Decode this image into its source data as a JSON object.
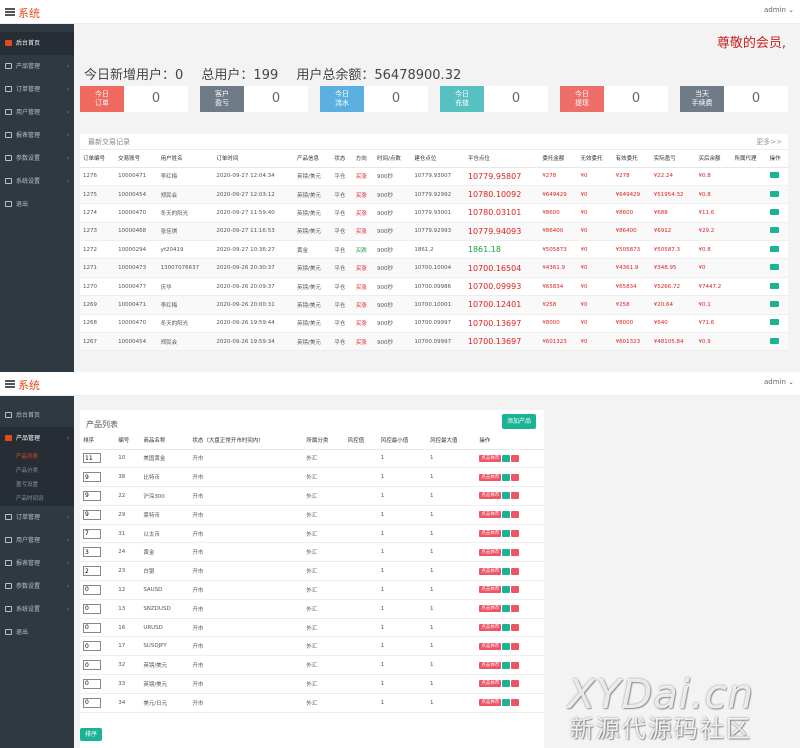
{
  "app": {
    "brand": "系统",
    "user": "admin ⌄"
  },
  "sidebar1": {
    "items": [
      {
        "label": "后台首页",
        "icon": "dashboard-icon",
        "active": true
      },
      {
        "label": "产品管理",
        "icon": "product-icon"
      },
      {
        "label": "订单管理",
        "icon": "order-icon"
      },
      {
        "label": "用户管理",
        "icon": "user-icon"
      },
      {
        "label": "报表管理",
        "icon": "report-icon"
      },
      {
        "label": "参数设置",
        "icon": "settings-icon"
      },
      {
        "label": "系统设置",
        "icon": "gear-icon"
      },
      {
        "label": "退出",
        "icon": "logout-icon"
      }
    ]
  },
  "dashboard": {
    "welcome": "尊敬的会员,",
    "stats": {
      "new_users": "今日新增用户：0",
      "total_users": "总用户：199",
      "total_balance": "用户总余额：56478900.32"
    },
    "cards": [
      {
        "label": "今日\n订单",
        "value": "0",
        "color": "#f0695f"
      },
      {
        "label": "客户\n盈亏",
        "value": "0",
        "color": "#6f7b86"
      },
      {
        "label": "今日\n流水",
        "value": "0",
        "color": "#5bb0e0"
      },
      {
        "label": "今日\n充值",
        "value": "0",
        "color": "#57c0c3"
      },
      {
        "label": "今日\n提现",
        "value": "0",
        "color": "#ee6f6a"
      },
      {
        "label": "当天\n手续费",
        "value": "0",
        "color": "#6f7b86"
      }
    ],
    "trades_title": "最新交易记录",
    "more": "更多>>",
    "columns": [
      "订单编号",
      "交易账号",
      "用户姓名",
      "订单时间",
      "产品信息",
      "状态",
      "方向",
      "时间/点数",
      "建仓点位",
      "平仓点位",
      "委托金额",
      "无效委托",
      "有效委托",
      "实际盈亏",
      "买后余额",
      "所属代理",
      "操作"
    ],
    "rows": [
      [
        "1276",
        "10000471",
        "李红梅",
        "2020-09-27 12:04:34",
        "英镑/美元",
        "平仓",
        "买涨",
        "900秒",
        "10779.93007",
        "10779.95807",
        "¥278",
        "¥0",
        "¥278",
        "¥22.24",
        "¥0.8",
        ""
      ],
      [
        "1275",
        "10000454",
        "郑民会",
        "2020-09-27 12:03:12",
        "英镑/美元",
        "平仓",
        "买涨",
        "900秒",
        "10779.92992",
        "10780.10092",
        "¥649429",
        "¥0",
        "¥649429",
        "¥51954.32",
        "¥0.8",
        ""
      ],
      [
        "1274",
        "10000470",
        "冬天的阳光",
        "2020-09-27 11:59:40",
        "英镑/美元",
        "平仓",
        "买涨",
        "900秒",
        "10779.93001",
        "10780.03101",
        "¥8600",
        "¥0",
        "¥8600",
        "¥688",
        "¥11.6",
        ""
      ],
      [
        "1273",
        "10000468",
        "张佳琪",
        "2020-09-27 11:16:53",
        "英镑/美元",
        "平仓",
        "买涨",
        "900秒",
        "10779.92993",
        "10779.94093",
        "¥86400",
        "¥0",
        "¥86400",
        "¥6912",
        "¥29.2",
        ""
      ],
      [
        "1272",
        "10000294",
        "yt20419",
        "2020-09-27 10:36:27",
        "黄金",
        "平仓",
        "买跌",
        "900秒",
        "1861.2",
        "1861.18",
        "¥505873",
        "¥0",
        "¥505873",
        "¥50587.3",
        "¥0.8",
        ""
      ],
      [
        "1271",
        "10000473",
        "13007076637",
        "2020-09-26 20:30:37",
        "英镑/美元",
        "平仓",
        "买涨",
        "900秒",
        "10700.10004",
        "10700.16504",
        "¥4361.9",
        "¥0",
        "¥4361.9",
        "¥348.95",
        "¥0",
        ""
      ],
      [
        "1270",
        "10000477",
        "庆华",
        "2020-09-26 20:09:37",
        "英镑/美元",
        "平仓",
        "买涨",
        "900秒",
        "10700.09986",
        "10700.09993",
        "¥65834",
        "¥0",
        "¥65834",
        "¥5266.72",
        "¥7447.2",
        ""
      ],
      [
        "1269",
        "10000471",
        "李红梅",
        "2020-09-26 20:00:31",
        "英镑/美元",
        "平仓",
        "买涨",
        "900秒",
        "10700.10001",
        "10700.12401",
        "¥258",
        "¥0",
        "¥258",
        "¥20.64",
        "¥0.1",
        ""
      ],
      [
        "1268",
        "10000470",
        "冬天的阳光",
        "2020-09-26 19:59:44",
        "英镑/美元",
        "平仓",
        "买涨",
        "900秒",
        "10700.09997",
        "10700.13697",
        "¥8000",
        "¥0",
        "¥8000",
        "¥640",
        "¥71.6",
        ""
      ],
      [
        "1267",
        "10000454",
        "郑民会",
        "2020-09-26 19:59:34",
        "英镑/美元",
        "平仓",
        "买涨",
        "900秒",
        "10700.09997",
        "10700.13697",
        "¥601323",
        "¥0",
        "¥601323",
        "¥48105.84",
        "¥0.9",
        ""
      ]
    ]
  },
  "sidebar2": {
    "items": [
      {
        "label": "后台首页",
        "icon": "dashboard-icon"
      },
      {
        "label": "产品管理",
        "icon": "product-icon",
        "active": true
      },
      {
        "label": "订单管理",
        "icon": "order-icon"
      },
      {
        "label": "用户管理",
        "icon": "user-icon"
      },
      {
        "label": "报表管理",
        "icon": "report-icon"
      },
      {
        "label": "参数设置",
        "icon": "settings-icon"
      },
      {
        "label": "系统设置",
        "icon": "gear-icon"
      },
      {
        "label": "退出",
        "icon": "logout-icon"
      }
    ],
    "subitems": [
      {
        "label": "产品列表",
        "active": true
      },
      {
        "label": "产品分类"
      },
      {
        "label": "盈亏设置"
      },
      {
        "label": "产品时间设"
      }
    ]
  },
  "products": {
    "title": "产品列表",
    "add_label": "添加产品",
    "columns": [
      "排序",
      "编号",
      "商品名称",
      "状态（大盘正常开市时间内）",
      "所属分类",
      "风控值",
      "风控最小值",
      "风控最大值",
      "操作"
    ],
    "action_label": "点击休市",
    "sort_button": "排序",
    "rows": [
      [
        "11",
        "10",
        "美国黄金",
        "开市",
        "外汇",
        "",
        "1",
        "1"
      ],
      [
        "9",
        "38",
        "比特币",
        "开市",
        "外汇",
        "",
        "1",
        "1"
      ],
      [
        "9",
        "22",
        "沪深300",
        "开市",
        "外汇",
        "",
        "1",
        "1"
      ],
      [
        "9",
        "29",
        "莱特币",
        "开市",
        "外汇",
        "",
        "1",
        "1"
      ],
      [
        "7",
        "31",
        "以太币",
        "开市",
        "外汇",
        "",
        "1",
        "1"
      ],
      [
        "3",
        "24",
        "黄金",
        "开市",
        "外汇",
        "",
        "1",
        "1"
      ],
      [
        "2",
        "23",
        "白银",
        "开市",
        "外汇",
        "",
        "1",
        "1"
      ],
      [
        "0",
        "12",
        "SAUSD",
        "开市",
        "外汇",
        "",
        "1",
        "1"
      ],
      [
        "0",
        "13",
        "SNZDUSD",
        "开市",
        "外汇",
        "",
        "1",
        "1"
      ],
      [
        "0",
        "16",
        "URUSD",
        "开市",
        "外汇",
        "",
        "1",
        "1"
      ],
      [
        "0",
        "17",
        "SUSDJPY",
        "开市",
        "外汇",
        "",
        "1",
        "1"
      ],
      [
        "0",
        "32",
        "英镑/美元",
        "开市",
        "外汇",
        "",
        "1",
        "1"
      ],
      [
        "0",
        "33",
        "英镑/美元",
        "开市",
        "外汇",
        "",
        "1",
        "1"
      ],
      [
        "0",
        "34",
        "美元/日元",
        "开市",
        "外汇",
        "",
        "1",
        "1"
      ]
    ]
  },
  "watermark": {
    "line1": "XYDai.cn",
    "line2": "新源代源码社区"
  }
}
